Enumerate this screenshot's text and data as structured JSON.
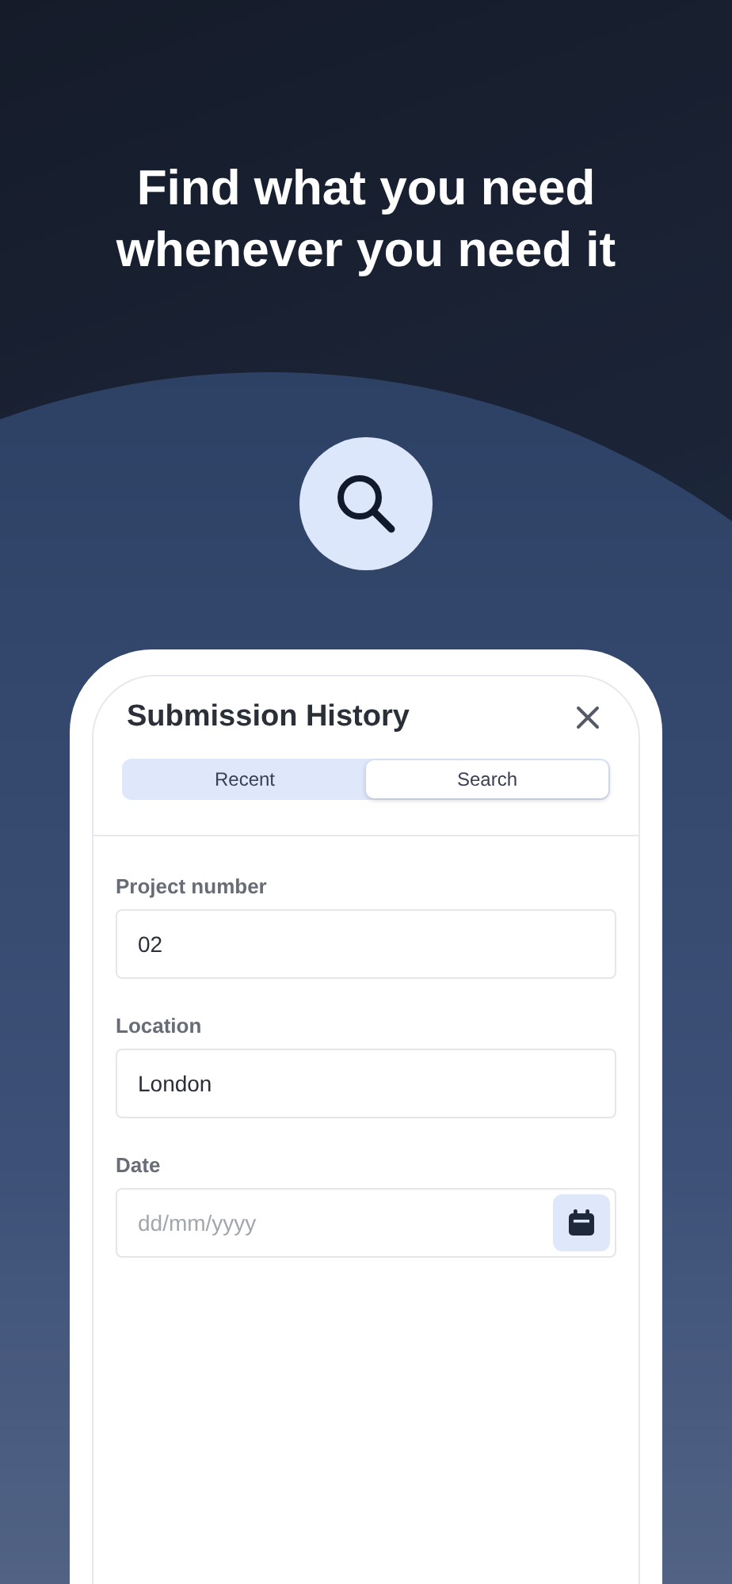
{
  "headline": "Find what you need whenever you need it",
  "dialog": {
    "title": "Submission History",
    "tabs": [
      {
        "label": "Recent",
        "selected": false
      },
      {
        "label": "Search",
        "selected": true
      }
    ],
    "fields": [
      {
        "kind": "text",
        "label": "Project number",
        "value": "02"
      },
      {
        "kind": "text",
        "label": "Location",
        "value": "London"
      },
      {
        "kind": "date",
        "label": "Date",
        "placeholder": "dd/mm/yyyy"
      }
    ]
  }
}
